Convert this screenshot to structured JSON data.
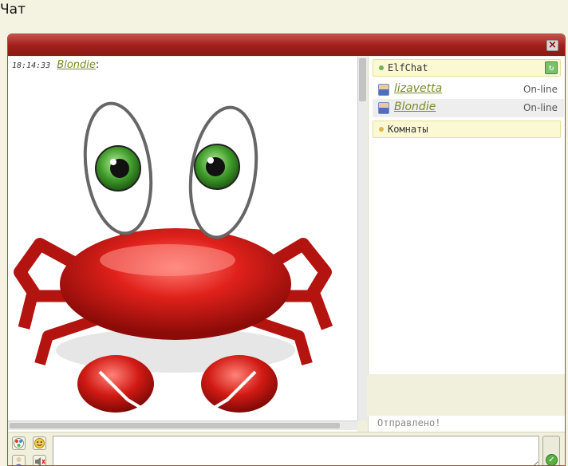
{
  "page": {
    "title": "Чат"
  },
  "window": {
    "close_symbol": "×"
  },
  "message": {
    "time": "18:14:33",
    "user": "Blondie",
    "colon": ":"
  },
  "rooms": {
    "main": {
      "name": "ElfChat"
    },
    "other": {
      "name": "Комнаты"
    }
  },
  "users": [
    {
      "name": "lizavetta",
      "status": "On-line"
    },
    {
      "name": "Blondie",
      "status": "On-line"
    }
  ],
  "status_text": "Отправлено!",
  "input": {
    "value": "",
    "placeholder": ""
  },
  "icons": {
    "close": "close-icon",
    "refresh": "refresh-icon",
    "color": "color-palette-icon",
    "smiley": "smiley-icon",
    "user": "user-icon",
    "sound": "sound-icon",
    "send": "send-check-icon"
  },
  "colors": {
    "titlebar": "#a01f1a",
    "username": "#7a8a2a",
    "room_dot_active": "#6fb35a",
    "room_dot_inactive": "#d7b84a"
  }
}
